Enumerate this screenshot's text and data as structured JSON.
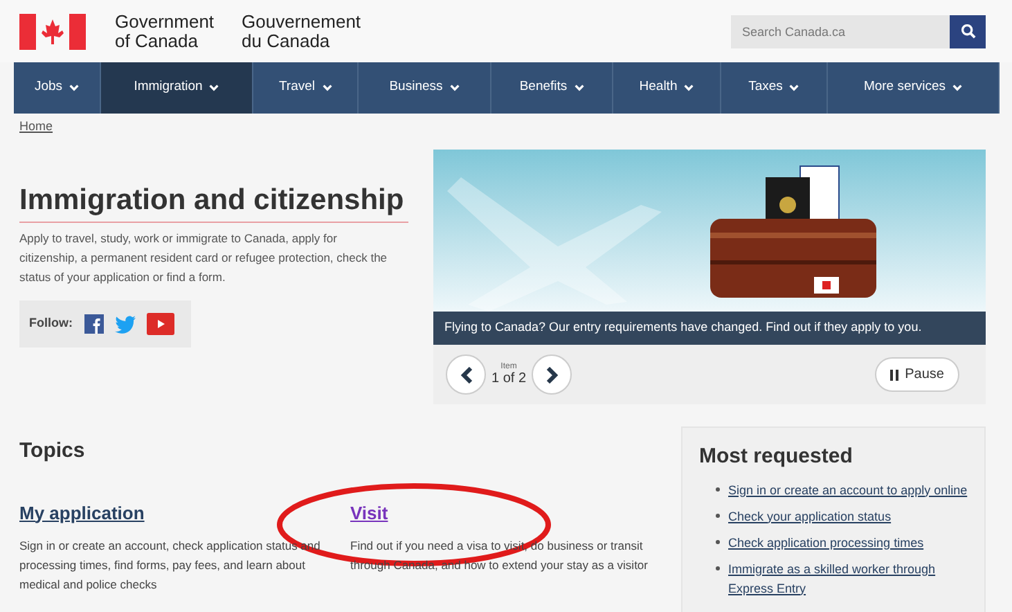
{
  "header": {
    "brand_en": [
      "Government",
      "of Canada"
    ],
    "brand_fr": [
      "Gouvernement",
      "du Canada"
    ],
    "search": {
      "placeholder": "Search Canada.ca"
    }
  },
  "nav": [
    {
      "label": "Jobs",
      "selected": false
    },
    {
      "label": "Immigration",
      "selected": true
    },
    {
      "label": "Travel",
      "selected": false
    },
    {
      "label": "Business",
      "selected": false
    },
    {
      "label": "Benefits",
      "selected": false
    },
    {
      "label": "Health",
      "selected": false
    },
    {
      "label": "Taxes",
      "selected": false
    },
    {
      "label": "More services",
      "selected": false
    }
  ],
  "breadcrumb": [
    "Home"
  ],
  "intro": {
    "title": "Immigration and citizenship",
    "text": "Apply to travel, study, work or immigrate to Canada, apply for citizenship, a permanent resident card or refugee protection, check the status of your application or find a form.",
    "follow_label": "Follow:"
  },
  "carousel": {
    "caption": "Flying to Canada? Our entry requirements have changed. Find out if they apply to you.",
    "item_label": "Item",
    "item_count": "1 of 2",
    "pause": "Pause"
  },
  "topics": {
    "title": "Topics",
    "items": [
      {
        "title": "My application",
        "visited": false,
        "text": "Sign in or create an account, check application status and processing times, find forms, pay fees, and learn about medical and police checks"
      },
      {
        "title": "Visit",
        "visited": true,
        "text": "Find out if you need a visa to visit, do business or transit through Canada, and how to extend your stay as a visitor"
      }
    ]
  },
  "most_requested": {
    "title": "Most requested",
    "links": [
      "Sign in or create an account to apply online",
      "Check your application status",
      "Check application processing times",
      "Immigrate as a skilled worker through Express Entry"
    ]
  }
}
